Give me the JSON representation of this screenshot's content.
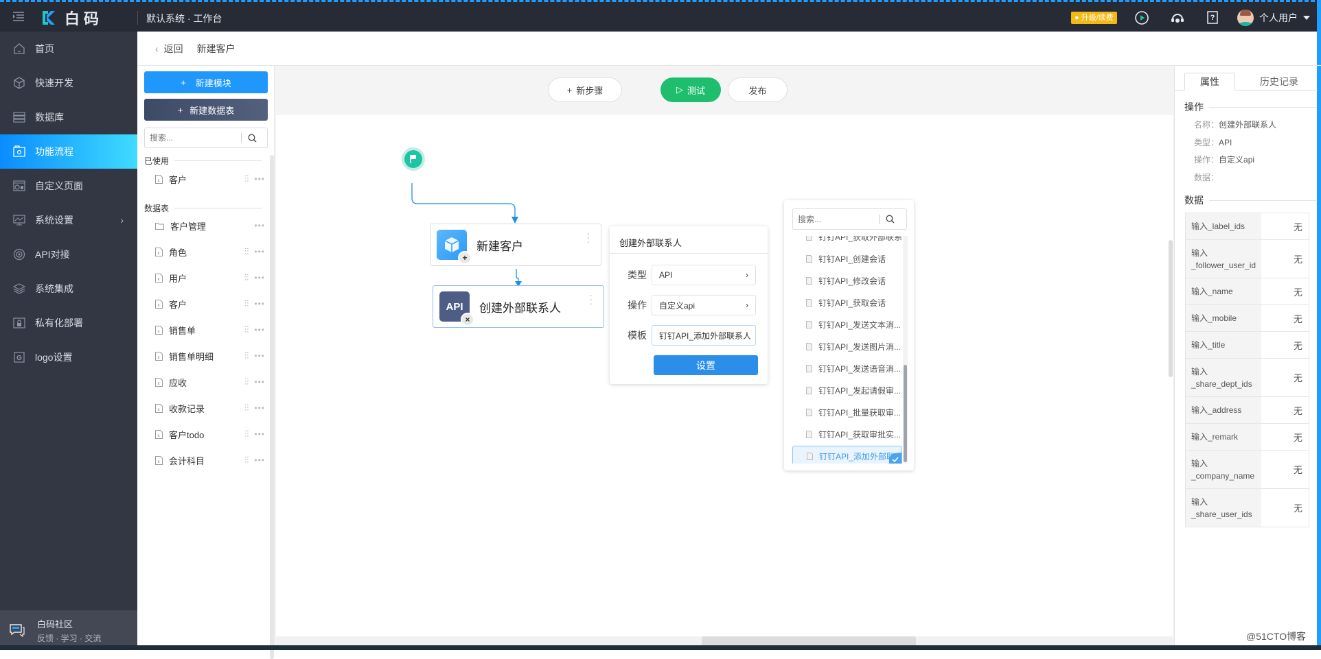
{
  "topbar": {
    "brand": "白码",
    "system_title": "默认系统 · 工作台",
    "upgrade_label": "升级/续费",
    "user_name": "个人用户",
    "icons": [
      "menu-toggle-icon",
      "play-tutorial-icon",
      "customer-service-icon",
      "help-icon"
    ]
  },
  "sidebar": {
    "items": [
      {
        "label": "首页",
        "icon": "home-icon"
      },
      {
        "label": "快速开发",
        "icon": "cube-icon"
      },
      {
        "label": "数据库",
        "icon": "database-icon"
      },
      {
        "label": "功能流程",
        "icon": "flow-icon",
        "active": true
      },
      {
        "label": "自定义页面",
        "icon": "page-icon"
      },
      {
        "label": "系统设置",
        "icon": "monitor-icon",
        "has_children": true
      },
      {
        "label": "API对接",
        "icon": "api-icon"
      },
      {
        "label": "系统集成",
        "icon": "layers-icon"
      },
      {
        "label": "私有化部署",
        "icon": "lock-icon"
      },
      {
        "label": "logo设置",
        "icon": "logo-icon"
      }
    ],
    "community": {
      "title": "白码社区",
      "subtitle": "反馈 · 学习 · 交流"
    }
  },
  "breadcrumb": {
    "back_label": "返回",
    "title": "新建客户"
  },
  "left_panel": {
    "new_module_label": "新建模块",
    "new_table_label": "新建数据表",
    "search_placeholder": "搜索...",
    "used_header": "已使用",
    "used_items": [
      {
        "label": "客户",
        "type": "table"
      }
    ],
    "tables_header": "数据表",
    "table_items": [
      {
        "label": "客户管理",
        "type": "folder"
      },
      {
        "label": "角色",
        "type": "table"
      },
      {
        "label": "用户",
        "type": "table"
      },
      {
        "label": "客户",
        "type": "table"
      },
      {
        "label": "销售单",
        "type": "table"
      },
      {
        "label": "销售单明细",
        "type": "table"
      },
      {
        "label": "应收",
        "type": "table"
      },
      {
        "label": "收款记录",
        "type": "table"
      },
      {
        "label": "客户todo",
        "type": "table"
      },
      {
        "label": "会计科目",
        "type": "table"
      }
    ]
  },
  "toolbar": {
    "new_step_label": "新步骤",
    "test_label": "测试",
    "publish_label": "发布"
  },
  "flow": {
    "nodes": [
      {
        "label": "新建客户",
        "icon": "cube-icon",
        "badge": "+"
      },
      {
        "label": "创建外部联系人",
        "icon_text": "API",
        "badge": "×",
        "selected": true
      }
    ]
  },
  "step_popup": {
    "title": "创建外部联系人",
    "type_label": "类型",
    "type_value": "API",
    "action_label": "操作",
    "action_value": "自定义api",
    "template_label": "模板",
    "template_value": "钉钉API_添加外部联系人",
    "set_button": "设置"
  },
  "template_list": {
    "search_placeholder": "搜索...",
    "items": [
      "钉钉API_获取外部联系...",
      "钉钉API_创建会话",
      "钉钉API_修改会话",
      "钉钉API_获取会话",
      "钉钉API_发送文本消...",
      "钉钉API_发送图片消...",
      "钉钉API_发送语音消...",
      "钉钉API_发起请假审...",
      "钉钉API_批量获取审...",
      "钉钉API_获取审批实...",
      "钉钉API_添加外部联系人"
    ],
    "selected_index": 10
  },
  "right_panel": {
    "tabs": [
      "属性",
      "历史记录"
    ],
    "active_tab": 0,
    "operation_header": "操作",
    "name_key": "名称：",
    "name_value": "创建外部联系人",
    "type_key": "类型：",
    "type_value": "API",
    "action_key": "操作：",
    "action_value": "自定义api",
    "data_key": "数据：",
    "data_value": "",
    "data_header": "数据",
    "data_rows": [
      {
        "key": "输入_label_ids",
        "value": "无"
      },
      {
        "key": "输入\n_follower_user_id",
        "value": "无"
      },
      {
        "key": "输入_name",
        "value": "无"
      },
      {
        "key": "输入_mobile",
        "value": "无"
      },
      {
        "key": "输入_title",
        "value": "无"
      },
      {
        "key": "输入\n_share_dept_ids",
        "value": "无"
      },
      {
        "key": "输入_address",
        "value": "无"
      },
      {
        "key": "输入_remark",
        "value": "无"
      },
      {
        "key": "输入\n_company_name",
        "value": "无"
      },
      {
        "key": "输入\n_share_user_ids",
        "value": "无"
      }
    ]
  },
  "watermark": "@51CTO博客"
}
